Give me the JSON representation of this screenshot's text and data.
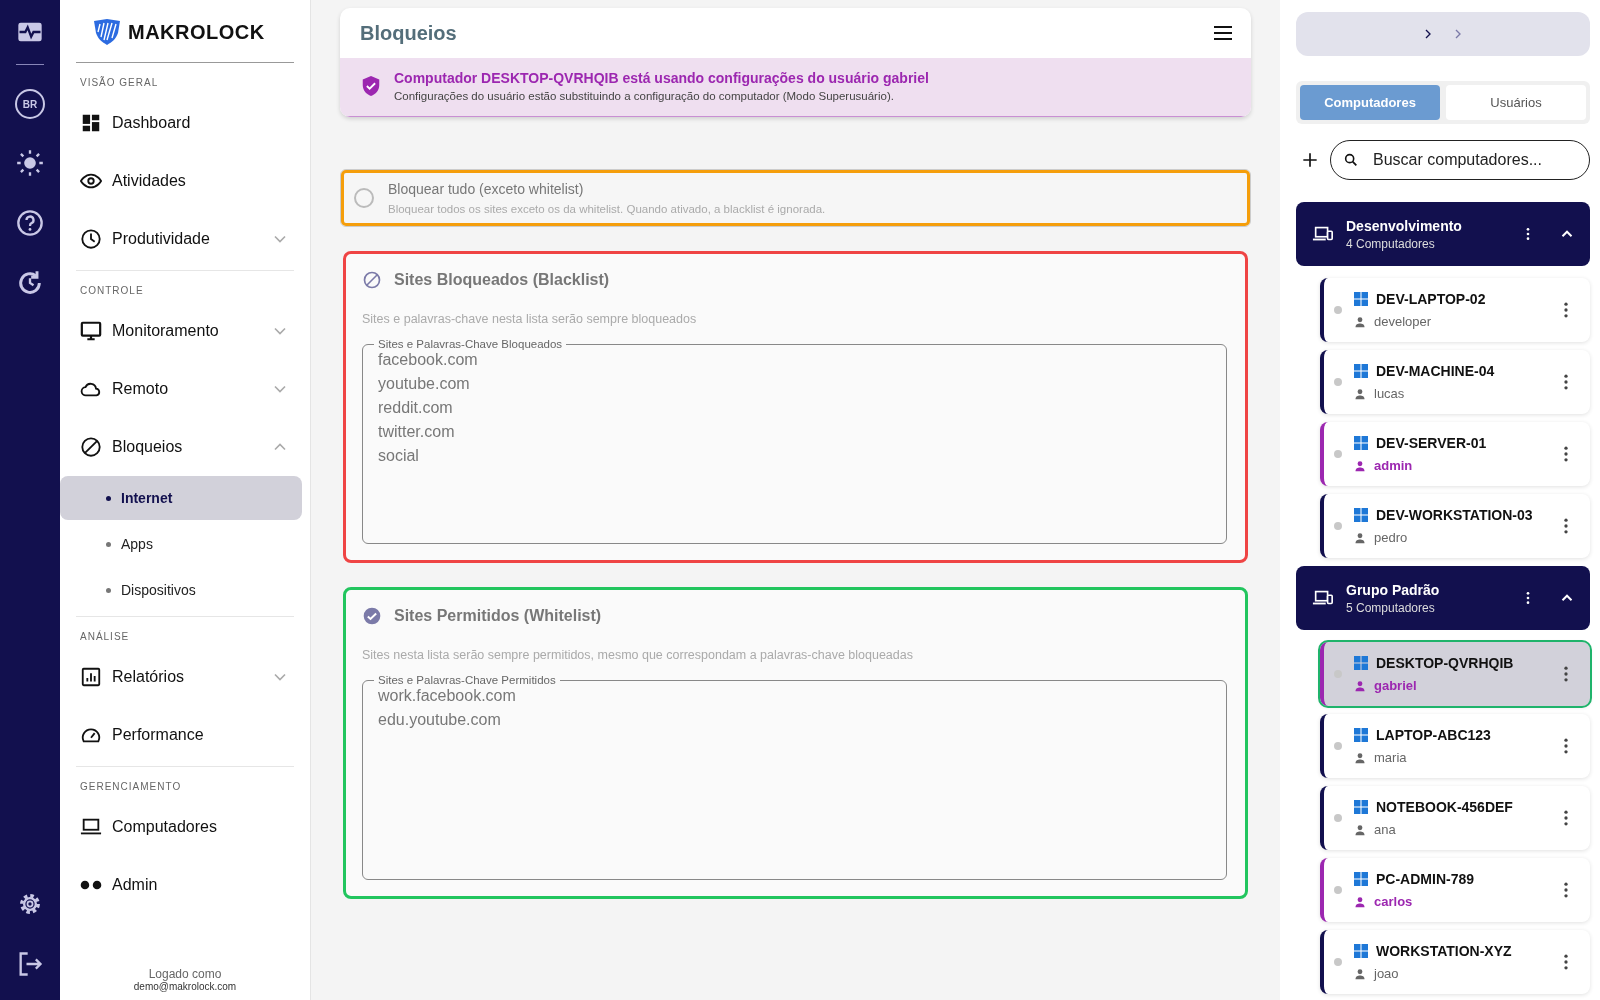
{
  "rail": {
    "badge": "BR"
  },
  "sidebar": {
    "logo": "MAKROLOCK",
    "sections": [
      {
        "heading": "VISÃO GERAL",
        "items": [
          {
            "label": "Dashboard"
          },
          {
            "label": "Atividades"
          },
          {
            "label": "Produtividade",
            "expanded": false
          }
        ]
      },
      {
        "heading": "CONTROLE",
        "items": [
          {
            "label": "Monitoramento",
            "expanded": false
          },
          {
            "label": "Remoto",
            "expanded": false
          },
          {
            "label": "Bloqueios",
            "expanded": true,
            "children": [
              {
                "label": "Internet",
                "selected": true
              },
              {
                "label": "Apps",
                "selected": false
              },
              {
                "label": "Dispositivos",
                "selected": false
              }
            ]
          }
        ]
      },
      {
        "heading": "ANÁLISE",
        "items": [
          {
            "label": "Relatórios",
            "expanded": false
          },
          {
            "label": "Performance"
          }
        ]
      },
      {
        "heading": "GERENCIAMENTO",
        "items": [
          {
            "label": "Computadores"
          },
          {
            "label": "Admin"
          }
        ]
      }
    ],
    "footer": {
      "label": "Logado como",
      "email": "demo@makrolock.com"
    }
  },
  "header": {
    "title": "Bloqueios"
  },
  "alert": {
    "title": "Computador DESKTOP-QVRHQIB está usando configurações do usuário gabriel",
    "message": "Configurações do usuário estão substituindo a configuração do computador (Modo Superusuário)."
  },
  "sections": [
    {
      "kind": "toggle",
      "color": "#f59e0b",
      "title": "Bloquear tudo (exceto whitelist)",
      "description": "Bloquear todos os sites exceto os da whitelist. Quando ativado, a blacklist é ignorada.",
      "checked": false
    },
    {
      "kind": "blocked",
      "color": "#ef4444",
      "title": "Sites Bloqueados (Blacklist)",
      "description": "Sites e palavras-chave nesta lista serão sempre bloqueados",
      "field_label": "Sites e Palavras-Chave Bloqueados",
      "entries": [
        "facebook.com",
        "youtube.com",
        "reddit.com",
        "twitter.com",
        "social"
      ]
    },
    {
      "kind": "allowed",
      "color": "#22c55e",
      "title": "Sites Permitidos (Whitelist)",
      "description": "Sites nesta lista serão sempre permitidos, mesmo que correspondam a palavras-chave bloqueadas",
      "field_label": "Sites e Palavras-Chave Permitidos",
      "entries": [
        "work.facebook.com",
        "edu.youtube.com"
      ]
    }
  ],
  "right_panel": {
    "tabs": [
      {
        "label": "Computadores",
        "selected": true
      },
      {
        "label": "Usuários",
        "selected": false
      }
    ],
    "search": {
      "placeholder": "Buscar computadores..."
    },
    "groups": [
      {
        "name": "Desenvolvimento",
        "count": "4 Computadores",
        "expanded": true,
        "computers": [
          {
            "name": "DEV-LAPTOP-02",
            "user": "developer",
            "superuser": false,
            "selected": false
          },
          {
            "name": "DEV-MACHINE-04",
            "user": "lucas",
            "superuser": false,
            "selected": false
          },
          {
            "name": "DEV-SERVER-01",
            "user": "admin",
            "superuser": true,
            "selected": false
          },
          {
            "name": "DEV-WORKSTATION-03",
            "user": "pedro",
            "superuser": false,
            "selected": false
          }
        ]
      },
      {
        "name": "Grupo Padrão",
        "count": "5 Computadores",
        "expanded": true,
        "computers": [
          {
            "name": "DESKTOP-QVRHQIB",
            "user": "gabriel",
            "superuser": true,
            "selected": true
          },
          {
            "name": "LAPTOP-ABC123",
            "user": "maria",
            "superuser": false,
            "selected": false
          },
          {
            "name": "NOTEBOOK-456DEF",
            "user": "ana",
            "superuser": false,
            "selected": false
          },
          {
            "name": "PC-ADMIN-789",
            "user": "carlos",
            "superuser": true,
            "selected": false
          },
          {
            "name": "WORKSTATION-XYZ",
            "user": "joao",
            "superuser": false,
            "selected": false
          }
        ]
      }
    ]
  }
}
